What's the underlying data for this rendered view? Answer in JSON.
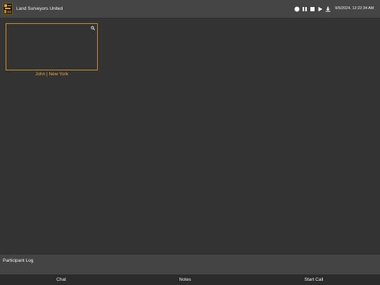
{
  "header": {
    "app_title": "Land Surveyors United",
    "logo_icon": "land-surveyors-logo",
    "datetime": "9/5/2024, 12:22:34 AM",
    "controls": [
      {
        "name": "record-icon"
      },
      {
        "name": "pause-icon"
      },
      {
        "name": "stop-icon"
      },
      {
        "name": "play-icon"
      },
      {
        "name": "download-icon"
      }
    ]
  },
  "participants": [
    {
      "caption": "John | New York",
      "expand_icon": "magnify-icon"
    }
  ],
  "log": {
    "label": "Participant Log"
  },
  "bottom_nav": {
    "chat": "Chat",
    "notes": "Notes",
    "start_call": "Start Call"
  },
  "colors": {
    "background": "#333333",
    "topbar": "#454545",
    "accent": "#c8922a",
    "caption": "#e0a93a",
    "log_bar": "#444444",
    "bottom_nav": "#2a2a2a"
  }
}
